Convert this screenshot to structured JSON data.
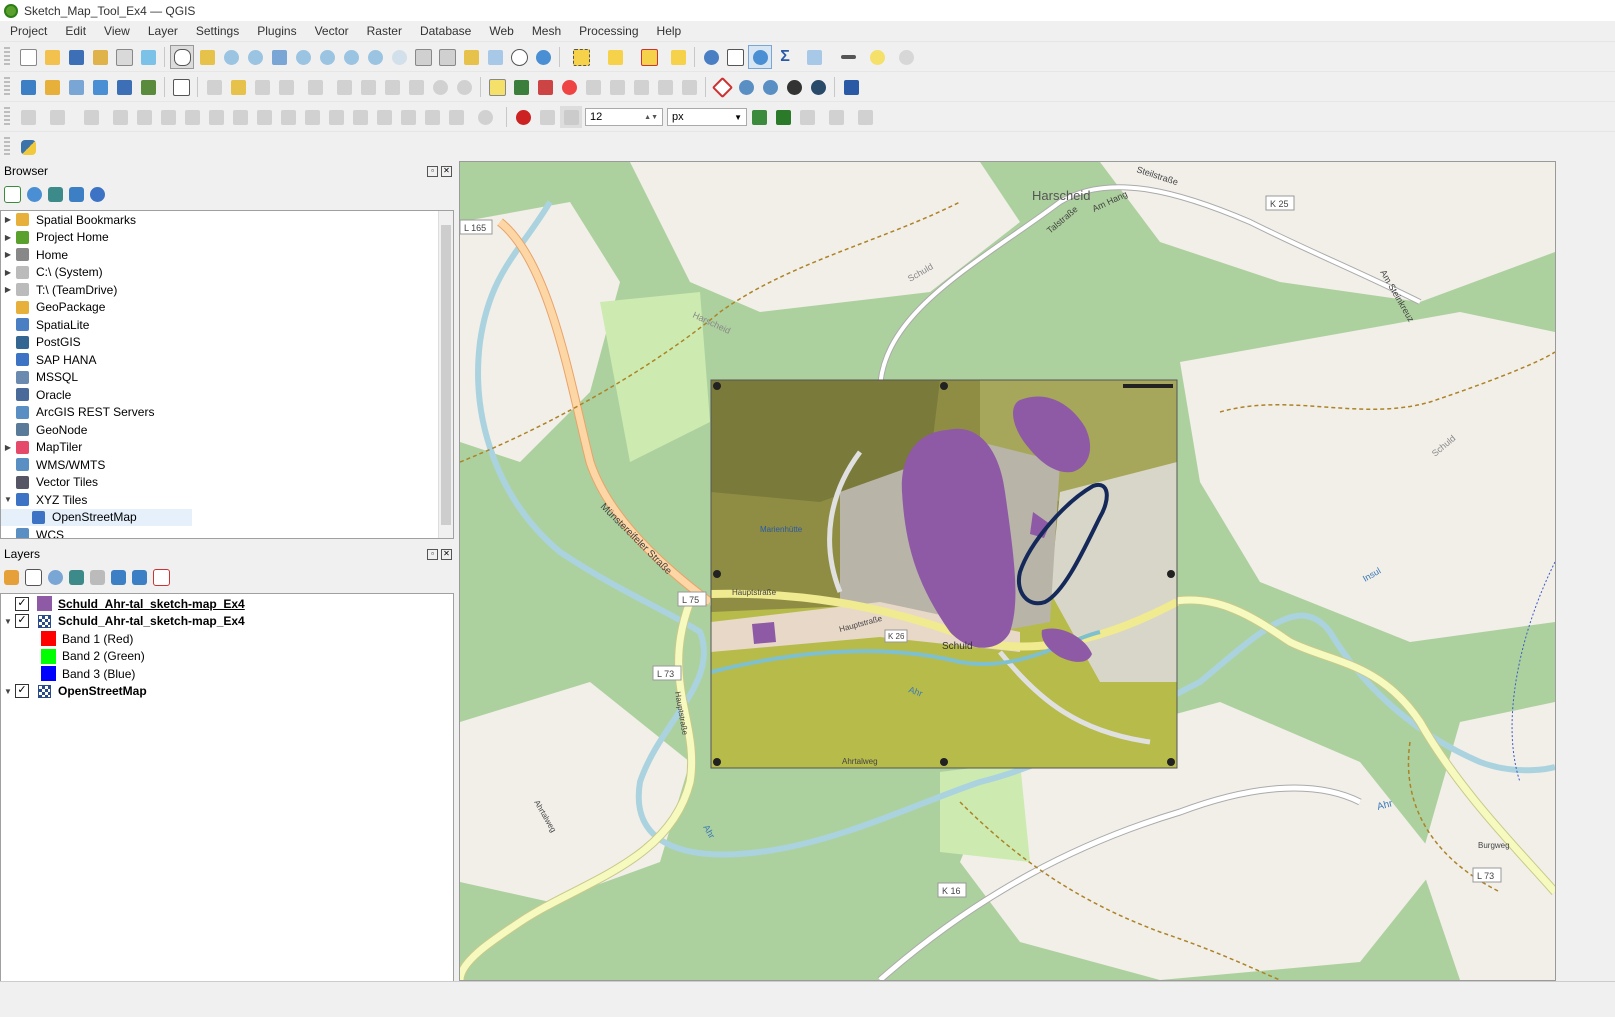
{
  "window": {
    "title": "Sketch_Map_Tool_Ex4 — QGIS"
  },
  "menu": [
    "Project",
    "Edit",
    "View",
    "Layer",
    "Settings",
    "Plugins",
    "Vector",
    "Raster",
    "Database",
    "Web",
    "Mesh",
    "Processing",
    "Help"
  ],
  "toolbar": {
    "font_size_value": "12",
    "unit_value": "px"
  },
  "browser": {
    "title": "Browser",
    "items": [
      {
        "label": "Spatial Bookmarks",
        "icon": "bookmark-icon",
        "arrow": "▶"
      },
      {
        "label": "Project Home",
        "icon": "project-home-icon",
        "arrow": "▶"
      },
      {
        "label": "Home",
        "icon": "home-icon",
        "arrow": "▶"
      },
      {
        "label": "C:\\ (System)",
        "icon": "drive-icon",
        "arrow": "▶"
      },
      {
        "label": "T:\\ (TeamDrive)",
        "icon": "drive-icon",
        "arrow": "▶"
      },
      {
        "label": "GeoPackage",
        "icon": "geopackage-icon",
        "arrow": ""
      },
      {
        "label": "SpatiaLite",
        "icon": "spatialite-icon",
        "arrow": ""
      },
      {
        "label": "PostGIS",
        "icon": "postgis-icon",
        "arrow": ""
      },
      {
        "label": "SAP HANA",
        "icon": "saphana-icon",
        "arrow": ""
      },
      {
        "label": "MSSQL",
        "icon": "mssql-icon",
        "arrow": ""
      },
      {
        "label": "Oracle",
        "icon": "oracle-icon",
        "arrow": ""
      },
      {
        "label": "ArcGIS REST Servers",
        "icon": "arcgis-icon",
        "arrow": ""
      },
      {
        "label": "GeoNode",
        "icon": "geonode-icon",
        "arrow": ""
      },
      {
        "label": "MapTiler",
        "icon": "maptiler-icon",
        "arrow": "▶"
      },
      {
        "label": "WMS/WMTS",
        "icon": "wms-icon",
        "arrow": ""
      },
      {
        "label": "Vector Tiles",
        "icon": "vector-tiles-icon",
        "arrow": ""
      },
      {
        "label": "XYZ Tiles",
        "icon": "xyz-tiles-icon",
        "arrow": "▼"
      },
      {
        "label": "OpenStreetMap",
        "icon": "xyz-tiles-icon",
        "arrow": "",
        "child": true,
        "selected": true
      },
      {
        "label": "WCS",
        "icon": "wcs-icon",
        "arrow": ""
      }
    ]
  },
  "layers": {
    "title": "Layers",
    "items": [
      {
        "label": "Schuld_Ahr-tal_sketch-map_Ex4",
        "type": "vector",
        "swatch": "#8e5aa6",
        "checked": true,
        "arrow": "",
        "underline": true
      },
      {
        "label": "Schuld_Ahr-tal_sketch-map_Ex4",
        "type": "raster",
        "checked": true,
        "arrow": "▼"
      },
      {
        "label": "Band 1 (Red)",
        "type": "band",
        "swatch": "#ff0000"
      },
      {
        "label": "Band 2 (Green)",
        "type": "band",
        "swatch": "#00ff00"
      },
      {
        "label": "Band 3 (Blue)",
        "type": "band",
        "swatch": "#0000ff"
      },
      {
        "label": "OpenStreetMap",
        "type": "raster",
        "checked": true,
        "arrow": "▼"
      }
    ]
  },
  "map": {
    "labels": {
      "harscheid": "Harscheid",
      "k25": "K 25",
      "l165": "L 165",
      "l75": "L 75",
      "l73a": "L 73",
      "l73b": "L 73",
      "k16": "K 16",
      "k26": "K 26",
      "muenstereifeler": "Münstereifeler Straße",
      "hauptstrasse": "Hauptstraße",
      "hauptstrasse2": "Hauptstraße",
      "hauptstrasse3": "Hauptstraße",
      "schuld": "Schuld",
      "schuld_road": "Schuld",
      "schuld_road2": "Schuld",
      "ahr1": "Ahr",
      "ahr2": "Ahr",
      "ahr3": "Ahr",
      "ahrtalweg": "Ahrtalweg",
      "burgweg": "Burgweg",
      "am_hang": "Am Hang",
      "am_steinkreuz": "Am Steinkreuz",
      "talstrasse": "Talstraße",
      "steilstrasse": "Steilstraße",
      "insul": "Insul",
      "harscheid_road": "Harscheid",
      "marienhuette": "Marienhütte"
    },
    "colors": {
      "sketch_polygon": "#8e5aa6",
      "sketch_outline": "#14285a",
      "forest": "#add19e",
      "land": "#f2efe9",
      "river": "#aad3df",
      "road_yellow": "#f7fabf",
      "road_orange": "#fcd6a4"
    }
  }
}
